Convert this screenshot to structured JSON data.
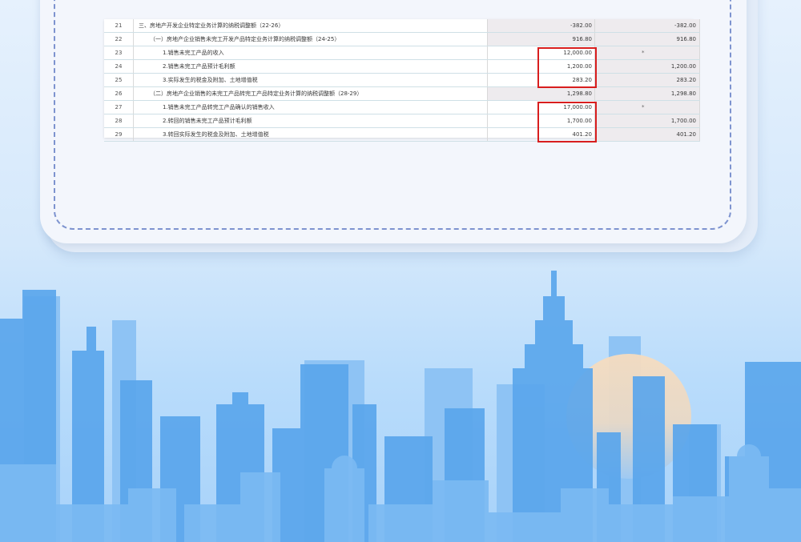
{
  "table": {
    "rows": [
      {
        "no": "21",
        "name": "三、房地产开发企业特定业务计算的纳税调整额（22-26）",
        "current": "-382.00",
        "total": "-382.00",
        "indent": 1,
        "grey": true,
        "highlight": false
      },
      {
        "no": "22",
        "name": "（一）房地产企业销售未完工开发产品特定业务计算的纳税调整额（24-25）",
        "current": "916.80",
        "total": "916.80",
        "indent": 2,
        "grey": true,
        "highlight": false
      },
      {
        "no": "23",
        "name": "1.销售未完工产品的收入",
        "current": "12,000.00",
        "total": "*",
        "indent": 3,
        "grey": false,
        "highlight": true
      },
      {
        "no": "24",
        "name": "2.销售未完工产品预计毛利额",
        "current": "1,200.00",
        "total": "1,200.00",
        "indent": 3,
        "grey": false,
        "highlight": true
      },
      {
        "no": "25",
        "name": "3.实际发生的税金及附加、土地增值税",
        "current": "283.20",
        "total": "283.20",
        "indent": 3,
        "grey": false,
        "highlight": true
      },
      {
        "no": "26",
        "name": "（二）房地产企业销售的未完工产品转完工产品特定业务计算的纳税调整额（28-29）",
        "current": "1,298.80",
        "total": "1,298.80",
        "indent": 2,
        "grey": true,
        "highlight": false
      },
      {
        "no": "27",
        "name": "1.销售未完工产品转完工产品确认的销售收入",
        "current": "17,000.00",
        "total": "*",
        "indent": 3,
        "grey": false,
        "highlight": true
      },
      {
        "no": "28",
        "name": "2.转回的销售未完工产品预计毛利额",
        "current": "1,700.00",
        "total": "1,700.00",
        "indent": 3,
        "grey": false,
        "highlight": true
      },
      {
        "no": "29",
        "name": "3.转回实际发生的税金及附加、土地增值税",
        "current": "401.20",
        "total": "401.20",
        "indent": 3,
        "grey": false,
        "highlight": true
      }
    ]
  },
  "colors": {
    "highlight_border": "#d81e1e",
    "dashed_border": "#7d93cf",
    "skyline": "#5aa6ec",
    "sun": "#f2d7b3"
  }
}
